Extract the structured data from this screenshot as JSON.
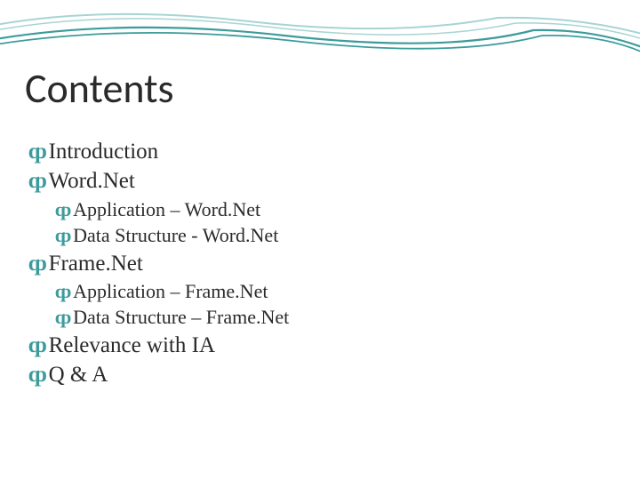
{
  "title": "Contents",
  "bullet_glyph": "ȹ",
  "items": [
    {
      "text": "Introduction",
      "level": 1
    },
    {
      "text": "Word.Net",
      "level": 1
    },
    {
      "text": "Application – Word.Net",
      "level": 2
    },
    {
      "text": "Data Structure - Word.Net",
      "level": 2
    },
    {
      "text": "Frame.Net",
      "level": 1
    },
    {
      "text": "Application – Frame.Net",
      "level": 2
    },
    {
      "text": "Data Structure – Frame.Net",
      "level": 2
    },
    {
      "text": "Relevance with IA",
      "level": 1
    },
    {
      "text": "Q & A",
      "level": 1
    }
  ],
  "colors": {
    "accent_teal": "#3d9b9b",
    "accent_teal_light": "#7bbdbd",
    "text": "#2a2a2a"
  }
}
